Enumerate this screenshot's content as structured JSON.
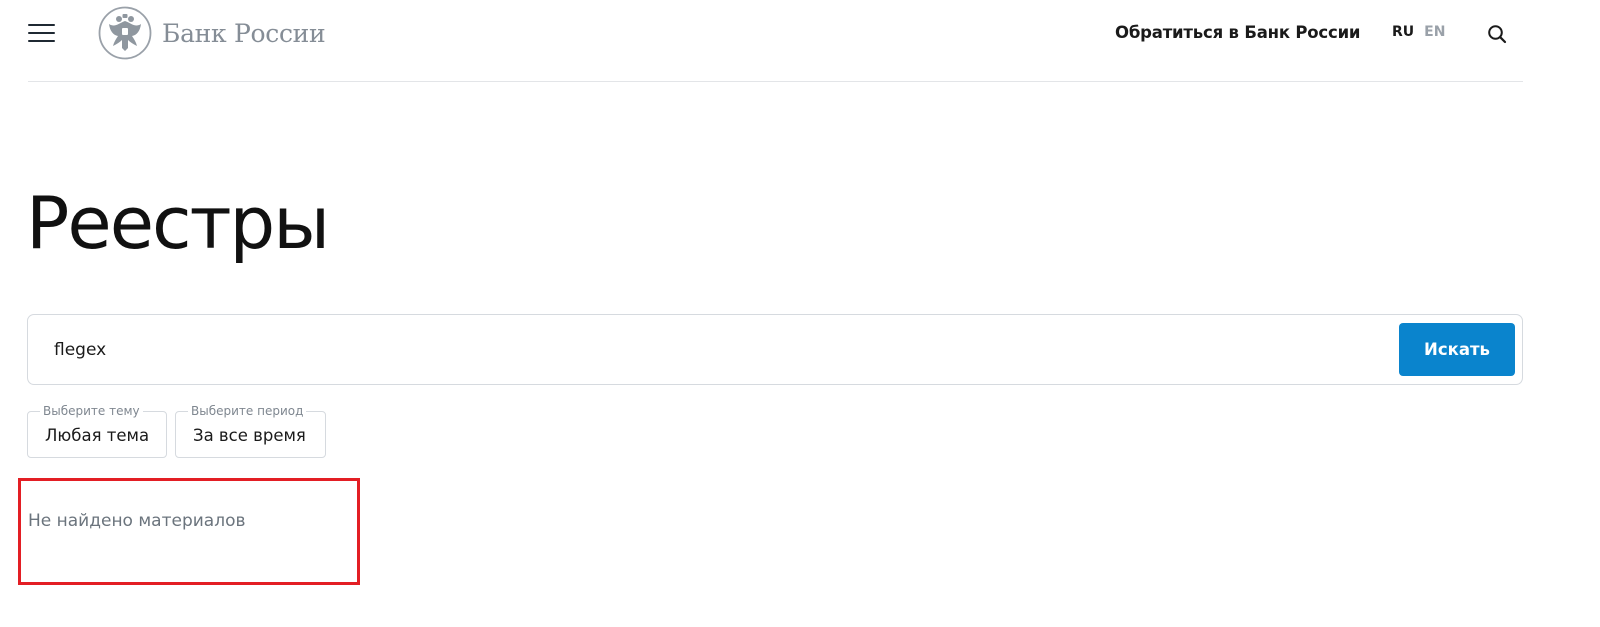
{
  "header": {
    "menu_icon": "hamburger-menu-icon",
    "logo_emblem": "double-headed-eagle-emblem",
    "logo_text": "Банк России",
    "contact_link": "Обратиться в Банк России",
    "lang_ru": "RU",
    "lang_en": "EN",
    "search_icon": "search-icon"
  },
  "main": {
    "title": "Реестры",
    "search": {
      "value": "flegex",
      "button_label": "Искать",
      "button_color": "#0a84cd"
    },
    "filters": [
      {
        "legend": "Выберите тему",
        "value": "Любая тема"
      },
      {
        "legend": "Выберите период",
        "value": "За все время"
      }
    ],
    "empty_message": "Не найдено материалов",
    "highlight_color": "#e31e24"
  }
}
